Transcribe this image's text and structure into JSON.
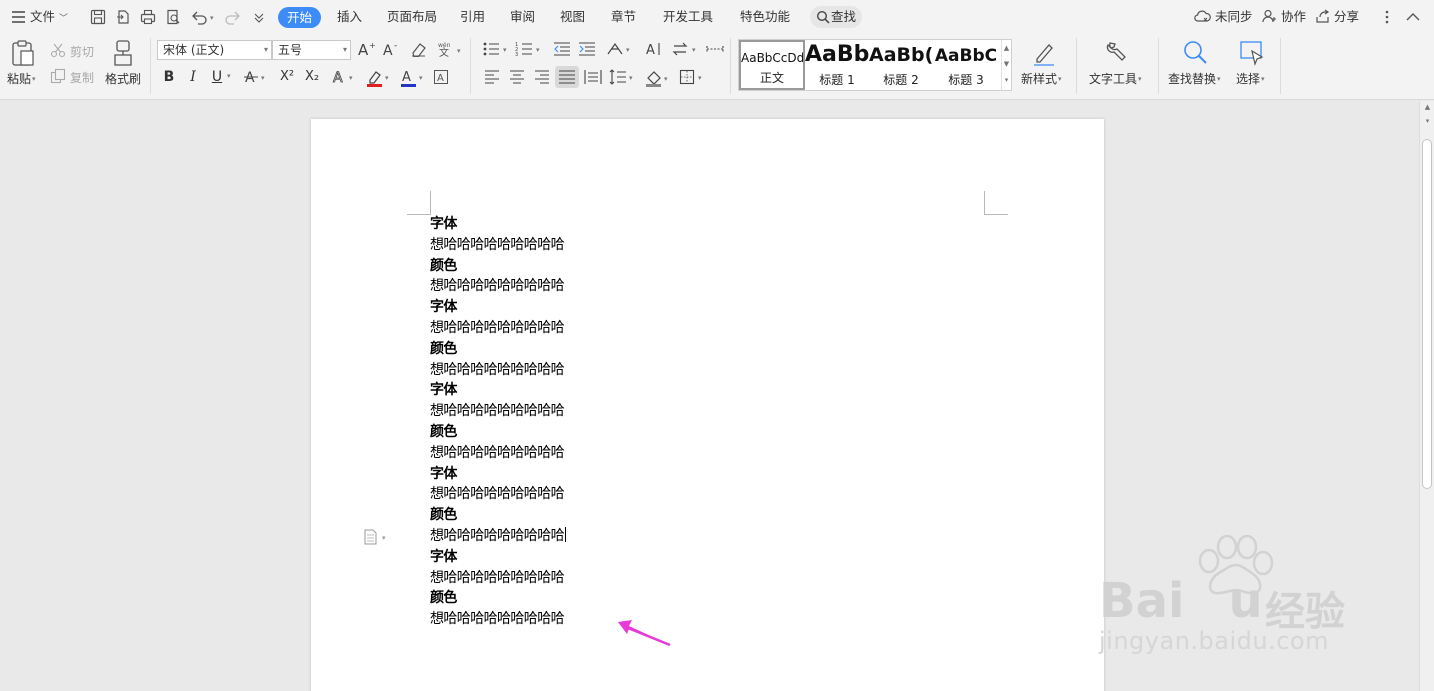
{
  "menubar": {
    "file_label": "文件",
    "tabs": [
      {
        "label": "开始"
      },
      {
        "label": "插入"
      },
      {
        "label": "页面布局"
      },
      {
        "label": "引用"
      },
      {
        "label": "审阅"
      },
      {
        "label": "视图"
      },
      {
        "label": "章节"
      },
      {
        "label": "开发工具"
      },
      {
        "label": "特色功能"
      }
    ],
    "search_label": "查找",
    "sync_label": "未同步",
    "collab_label": "协作",
    "share_label": "分享"
  },
  "ribbon": {
    "paste_label": "粘贴",
    "cut_label": "剪切",
    "copy_label": "复制",
    "format_painter_label": "格式刷",
    "font_name": "宋体 (正文)",
    "font_size": "五号",
    "bold_glyph": "B",
    "italic_glyph": "I",
    "underline_glyph": "U",
    "superscript_glyph": "X²",
    "subscript_glyph": "X₂",
    "styles": [
      {
        "sample": "AaBbCcDd",
        "name": "正文"
      },
      {
        "sample": "AaBb",
        "name": "标题 1"
      },
      {
        "sample": "AaBb(",
        "name": "标题 2"
      },
      {
        "sample": "AaBbC",
        "name": "标题 3"
      }
    ],
    "new_style_label": "新样式",
    "text_tools_label": "文字工具",
    "find_replace_label": "查找替换",
    "select_label": "选择"
  },
  "document": {
    "paragraphs": [
      {
        "text": "字体",
        "bold": true
      },
      {
        "text": "想哈哈哈哈哈哈哈哈哈",
        "bold": false
      },
      {
        "text": "颜色",
        "bold": true
      },
      {
        "text": "想哈哈哈哈哈哈哈哈哈",
        "bold": false
      },
      {
        "text": "字体",
        "bold": true
      },
      {
        "text": "想哈哈哈哈哈哈哈哈哈",
        "bold": false
      },
      {
        "text": "颜色",
        "bold": true
      },
      {
        "text": "想哈哈哈哈哈哈哈哈哈",
        "bold": false
      },
      {
        "text": "字体",
        "bold": true
      },
      {
        "text": "想哈哈哈哈哈哈哈哈哈",
        "bold": false
      },
      {
        "text": "颜色",
        "bold": true
      },
      {
        "text": "想哈哈哈哈哈哈哈哈哈",
        "bold": false
      },
      {
        "text": "字体",
        "bold": true
      },
      {
        "text": "想哈哈哈哈哈哈哈哈哈",
        "bold": false
      },
      {
        "text": "颜色",
        "bold": true
      },
      {
        "text": "想哈哈哈哈哈哈哈哈哈",
        "bold": false
      },
      {
        "text": "字体",
        "bold": true
      },
      {
        "text": "想哈哈哈哈哈哈哈哈哈",
        "bold": false
      },
      {
        "text": "颜色",
        "bold": true
      },
      {
        "text": "想哈哈哈哈哈哈哈哈哈",
        "bold": false
      }
    ],
    "caret_paragraph_index": 15
  },
  "watermark": {
    "brand": "Bai",
    "brand_tail": "u",
    "cn": "经验",
    "url": "jingyan.baidu.com"
  },
  "colors": {
    "accent": "#3c8bf6",
    "annotation_arrow": "#e83ad9",
    "font_color_bar": "#2335c8",
    "highlight_bar": "#e02020"
  },
  "icons": [
    "menu-icon",
    "save-icon",
    "print-icon",
    "undo-icon",
    "redo-icon",
    "search-icon",
    "cloud-icon",
    "user-icon",
    "share-icon",
    "more-icon",
    "collapse-icon",
    "paste-icon",
    "cut-icon",
    "copy-icon",
    "brush-icon",
    "doc-icon",
    "arrow-icon"
  ]
}
